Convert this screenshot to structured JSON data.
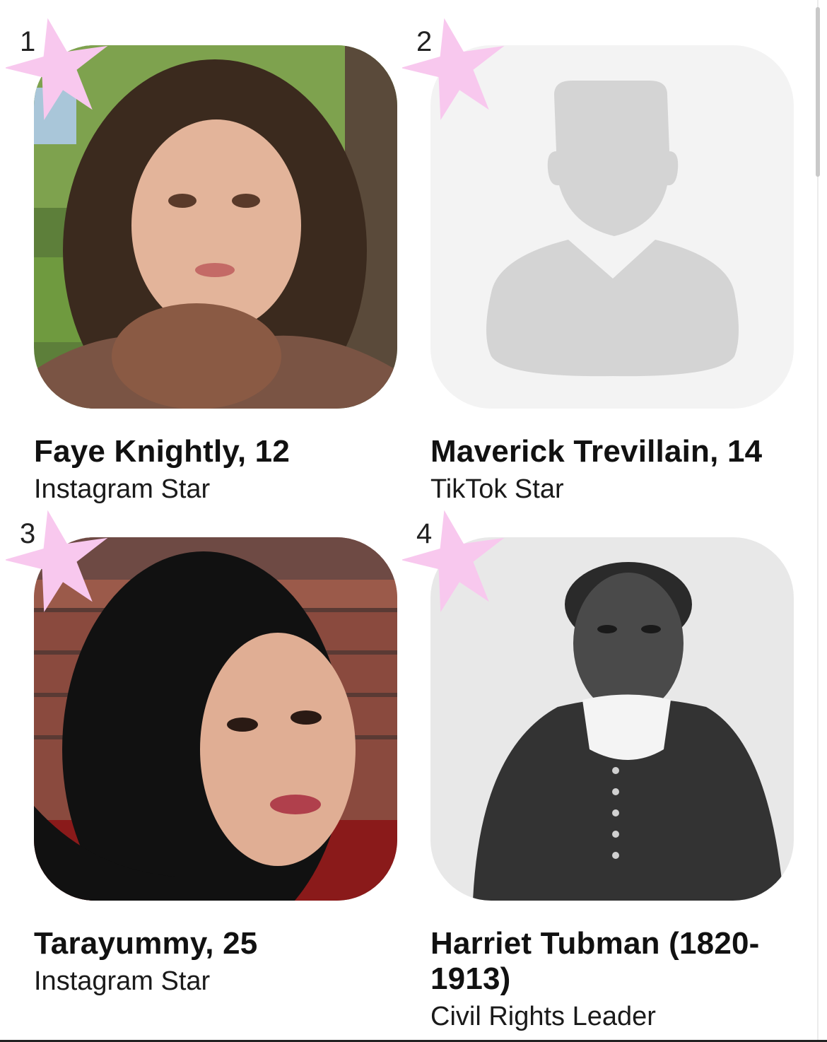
{
  "accent_star_color": "#f8c8ee",
  "cards": [
    {
      "rank": "1",
      "name": "Faye Knightly, 12",
      "role": "Instagram Star",
      "photo": "portrait-photo"
    },
    {
      "rank": "2",
      "name": "Maverick Trevillain, 14",
      "role": "TikTok Star",
      "photo": "default-avatar-icon"
    },
    {
      "rank": "3",
      "name": "Tarayummy, 25",
      "role": "Instagram Star",
      "photo": "portrait-photo"
    },
    {
      "rank": "4",
      "name": "Harriet Tubman (1820-1913)",
      "role": "Civil Rights Leader",
      "photo": "historic-portrait-photo"
    }
  ]
}
